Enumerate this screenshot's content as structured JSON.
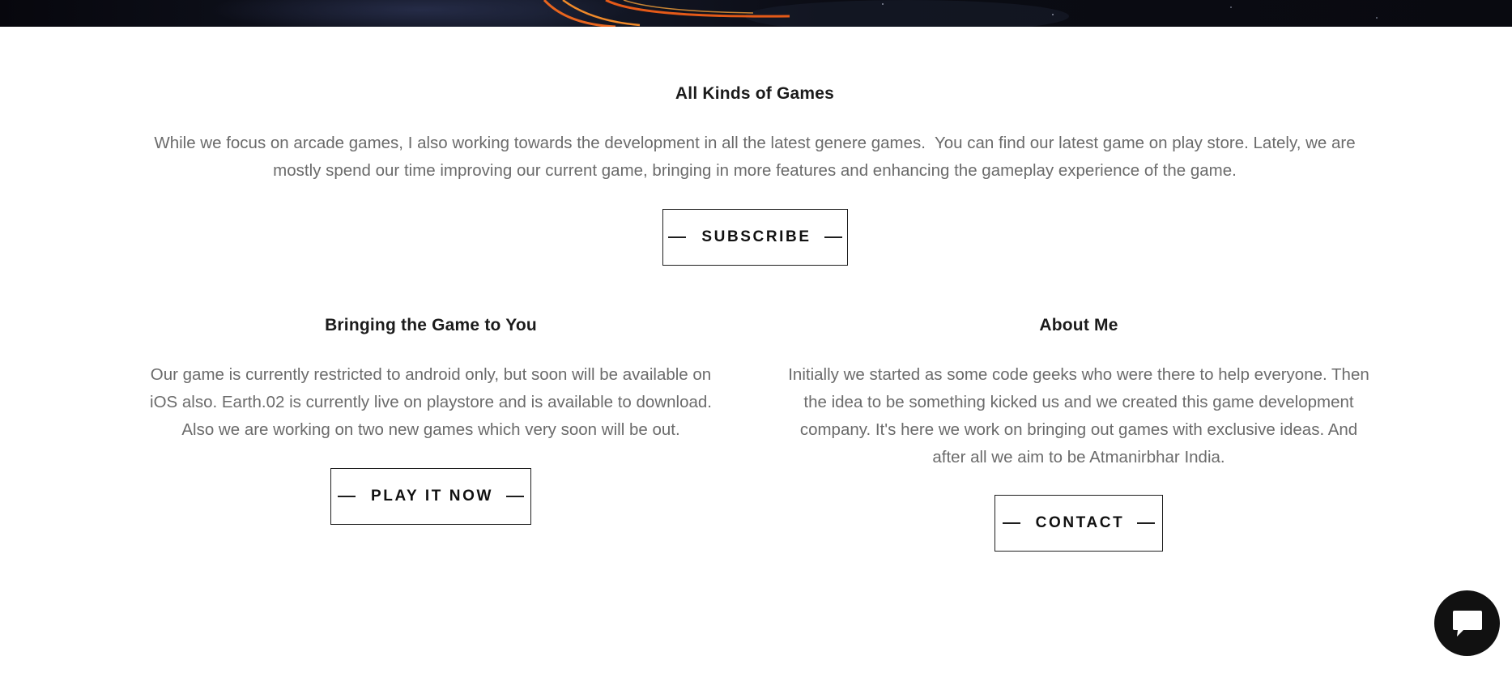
{
  "hero": {
    "colors": {
      "background": "#0a0b12",
      "streak_primary": "#e8651e",
      "streak_secondary": "#f5a03a"
    }
  },
  "games_section": {
    "title": "All Kinds of Games",
    "text_line1": "While we focus on arcade games, I also working towards the development in all the latest genere games.  You can find our latest game on play store. Lately, we are",
    "text_line2": "mostly spend our time improving our current game, bringing in more features and enhancing the gameplay experience of the game.",
    "button_label": "SUBSCRIBE"
  },
  "play_section": {
    "title": "Bringing the Game to You",
    "text_lines": [
      "Our game is currently restricted to android only, but soon will be available on",
      "iOS also. Earth.02 is currently live on playstore and is available to download.",
      "Also we are working on two new games which very soon will be out."
    ],
    "button_label": "PLAY IT NOW"
  },
  "about_section": {
    "title": "About Me",
    "text_lines": [
      "Initially we started as some code geeks who were there to help everyone. Then",
      "the idea to be something kicked us and we created this game development",
      "company. It's here we work on bringing out games with exclusive ideas. And",
      "after all we aim to be Atmanirbhar India."
    ],
    "button_label": "CONTACT"
  },
  "chat_widget": {
    "icon": "chat-bubble-icon",
    "colors": {
      "background": "#111111",
      "icon": "#ffffff"
    }
  }
}
